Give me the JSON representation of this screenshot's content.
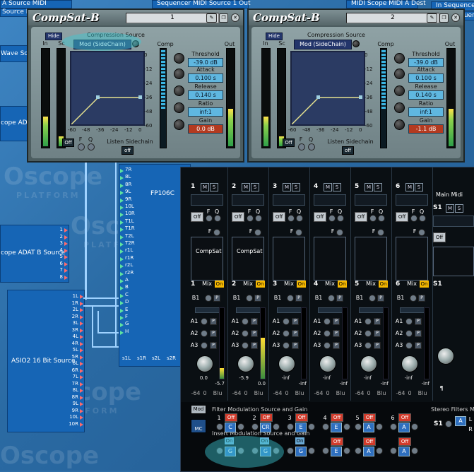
{
  "top_strip": {
    "left_labels": [
      "A Source MIDI",
      "Source MIDI"
    ],
    "right_labels": [
      "Sequencer MIDI Source 1 Out",
      "MIDI Scope MIDI A Dest",
      "In Sequence",
      "MIDI Sequence"
    ]
  },
  "modules": {
    "wave_source": "Wave Source",
    "adat_a": "cope ADAT A",
    "adat_b": "cope ADAT B Source",
    "asio": "ASIO2 16 Bit Source",
    "fp106c": "FP106C"
  },
  "watermark": {
    "brand": "Oscope",
    "sub": "PLATFORM"
  },
  "fp_inputs": [
    "7R",
    "8L",
    "8R",
    "9L",
    "9R",
    "10L",
    "10R",
    "T1L",
    "T1R",
    "T2L",
    "T2R",
    "r1L",
    "r1R",
    "r2L",
    "r2R",
    "A",
    "B",
    "C",
    "D",
    "E",
    "F",
    "G",
    "H"
  ],
  "fp_outputs": [
    "s1L",
    "s1R",
    "s2L",
    "s2R"
  ],
  "asio_pins": [
    "1L",
    "1R",
    "2L",
    "2R",
    "3L",
    "3R",
    "4L",
    "4R",
    "5L",
    "5R",
    "6L",
    "6R",
    "7L",
    "7R",
    "8L",
    "8R",
    "9L",
    "9R",
    "10L",
    "10R"
  ],
  "adat_b_pins": [
    "1",
    "2",
    "3",
    "4",
    "5",
    "6",
    "7",
    "8"
  ],
  "comps": [
    {
      "title": "CompSat-B",
      "number": "1",
      "hide": "Hide",
      "in_label": "In",
      "sc_label": "Sc",
      "cs_label": "Compression Source",
      "cs_value": "Mod (SideChain)",
      "comp_label": "Comp",
      "out_label": "Out",
      "threshold_label": "Threshold",
      "threshold": "-39.0 dB",
      "attack_label": "Attack",
      "attack": "0.100 s",
      "release_label": "Release",
      "release": "0.140 s",
      "ratio_label": "Ratio",
      "ratio": "inf:1",
      "gain_label": "Gain",
      "gain": "0.0 dB",
      "off": "Off",
      "f": "F",
      "q": "Q",
      "listen": "Listen Sidechain",
      "listen_state": "off",
      "xticks": [
        "-60",
        "-48",
        "-36",
        "-24",
        "-12",
        "0"
      ],
      "yticks": [
        "0",
        "-12",
        "-24",
        "-36",
        "-48",
        "-60"
      ]
    },
    {
      "title": "CompSat-B",
      "number": "2",
      "hide": "Hide",
      "in_label": "In",
      "sc_label": "Sc",
      "cs_label": "Compression Source",
      "cs_value": "Mod (SideChain)",
      "comp_label": "Comp",
      "out_label": "Out",
      "threshold_label": "Threshold",
      "threshold": "-39.0 dB",
      "attack_label": "Attack",
      "attack": "0.100 s",
      "release_label": "Release",
      "release": "0.140 s",
      "ratio_label": "Ratio",
      "ratio": "inf:1",
      "gain_label": "Gain",
      "gain": "-1.1 dB",
      "off": "Off",
      "f": "F",
      "q": "Q",
      "listen": "Listen Sidechain",
      "listen_state": "off",
      "xticks": [
        "-60",
        "-48",
        "-36",
        "-24",
        "-12",
        "0"
      ],
      "yticks": [
        "0",
        "-12",
        "-24",
        "-36",
        "-48",
        "-60"
      ]
    }
  ],
  "mixer": {
    "m": "M",
    "s": "S",
    "off": "Off",
    "on": "On",
    "mix": "Mix",
    "f": "F",
    "q": "Q",
    "b1": "B1",
    "a1": "A1",
    "a2": "A2",
    "a3": "A3",
    "p": "P",
    "blu": "Blu",
    "pan_value": "0",
    "channels": [
      {
        "num": "1",
        "slot": "CompSat",
        "readout_l": "0.0",
        "readout_r": "-5.7",
        "level": 0.15
      },
      {
        "num": "2",
        "slot": "CompSat",
        "readout_l": "-5.9",
        "readout_r": "0.0",
        "level": 0.58
      },
      {
        "num": "3",
        "slot": "",
        "readout_l": "-inf",
        "readout_r": "-inf",
        "level": 0
      },
      {
        "num": "4",
        "slot": "",
        "readout_l": "-inf",
        "readout_r": "-inf",
        "level": 0
      },
      {
        "num": "5",
        "slot": "",
        "readout_l": "-inf",
        "readout_r": "-inf",
        "level": 0
      },
      {
        "num": "6",
        "slot": "",
        "readout_l": "-inf",
        "readout_r": "-inf",
        "level": 0
      }
    ],
    "main_midi": "Main Midi",
    "s1": "S1",
    "pilcrow": "¶",
    "neg64": "-64",
    "mod_btn": "Mod",
    "mc_btn": "MC",
    "filter_mod_title": "Filter Modulation Source and Gain",
    "insert_mod_title": "Insert Modulation Source and Gain",
    "stereo_filters": "Stereo Filters Mo",
    "filter_sources": [
      "C",
      "CR",
      "E",
      "E",
      "A",
      "A"
    ],
    "insert_sources": [
      "G",
      "G",
      "G",
      "E",
      "A",
      "A"
    ],
    "s1_right": [
      "A",
      "L",
      "R"
    ]
  },
  "colors": {
    "accent_on": "#f6b800",
    "meter_red": "#b33a20",
    "value_cyan": "#5fb7e0"
  }
}
